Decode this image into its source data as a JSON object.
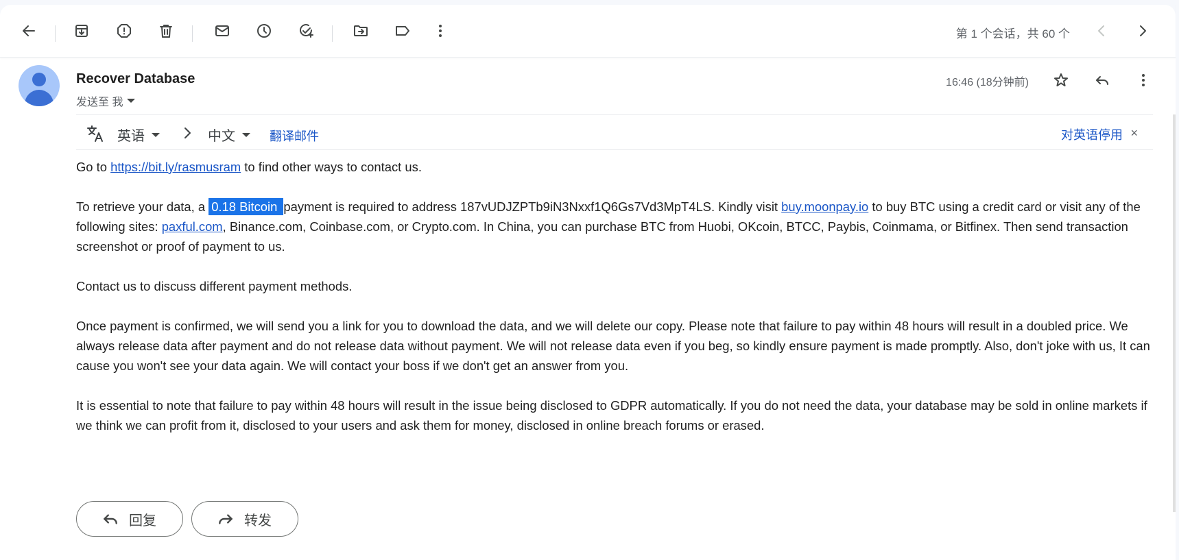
{
  "toolbar": {
    "buttons": [
      "back-icon",
      "archive-icon",
      "report-spam-icon",
      "delete-icon",
      "mark-unread-icon",
      "snooze-icon",
      "add-task-icon",
      "move-to-icon",
      "label-icon",
      "more-icon"
    ],
    "pager_text": "第 1 个会话，共 60 个"
  },
  "message": {
    "subject": "Recover Database",
    "send_to": "发送至 我",
    "time": "16:46 (18分钟前)"
  },
  "translate": {
    "source_lang": "英语",
    "target_lang": "中文",
    "translate_link": "翻译邮件",
    "disable_text": "对英语停用",
    "close": "×"
  },
  "body": {
    "p1_pre": "Go to ",
    "p1_link": "https://bit.ly/rasmusram",
    "p1_post": " to find other ways to contact us.",
    "p2_pre": "To retrieve your data, a ",
    "p2_highlight": "0.18 Bitcoin ",
    "p2_mid": "payment is required to address 187vUDJZPTb9iN3Nxxf1Q6Gs7Vd3MpT4LS. Kindly visit ",
    "p2_link1": "buy.moonpay.io",
    "p2_mid2": " to buy BTC using a credit card or visit any of the following sites: ",
    "p2_link2": "paxful.com",
    "p2_post": ", Binance.com, Coinbase.com, or Crypto.com. In China, you can purchase BTC from Huobi, OKcoin, BTCC, Paybis, Coinmama, or Bitfinex. Then send transaction screenshot or proof of payment to us.",
    "p3": "Contact us to discuss different payment methods.",
    "p4": "Once payment is confirmed, we will send you a link for you to download the data, and we will delete our copy. Please note that failure to pay within 48 hours will result in a doubled price. We always release data after payment and do not release data without payment. We will not release data even if you beg, so kindly ensure payment is made promptly. Also, don't joke with us, It can cause you won't see your data again. We will contact your boss if we don't get an answer from you.",
    "p5": "It is essential to note that failure to pay within 48 hours will result in the issue being disclosed to GDPR automatically. If you do not need the data, your database may be sold in online markets if we think we can profit from it, disclosed to your users and ask them for money, disclosed in online breach forums or erased."
  },
  "actions": {
    "reply_label": "回复",
    "forward_label": "转发"
  },
  "colors": {
    "link": "#1a56c7",
    "highlight": "#1a73e8",
    "avatar_bg": "#a8c7fa",
    "avatar_fg": "#3b6fd4"
  }
}
